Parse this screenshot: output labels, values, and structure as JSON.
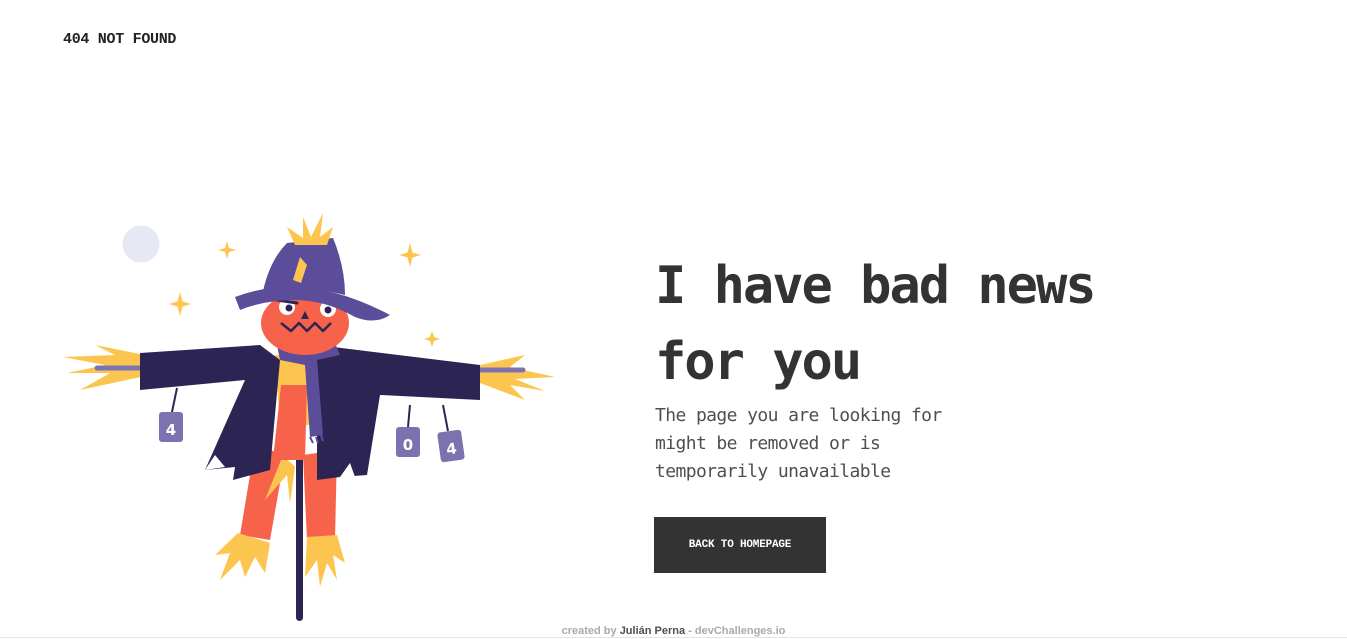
{
  "header": {
    "brand": "404 NOT FOUND"
  },
  "illustration": {
    "subject": "scarecrow-illustration",
    "can_labels": [
      "4",
      "0",
      "4"
    ],
    "colors": {
      "hat": "#5b4d9a",
      "coat": "#2c2554",
      "face": "#f7624a",
      "straw": "#fcc54f",
      "can": "#7d72b0",
      "moon": "#e6e8f4",
      "pole": "#2c2554"
    }
  },
  "main": {
    "headline": "I have bad news for you",
    "description": "The page you are looking for might be removed or is temporarily unavailable",
    "cta_label": "BACK TO HOMEPAGE"
  },
  "footer": {
    "prefix": "created by",
    "author": "Julián Perna",
    "separator": "-",
    "site": "devChallenges.io"
  },
  "theme": {
    "text": "#333333",
    "muted": "#4f4f4f",
    "button_bg": "#333333",
    "button_text": "#ffffff",
    "background": "#ffffff"
  }
}
